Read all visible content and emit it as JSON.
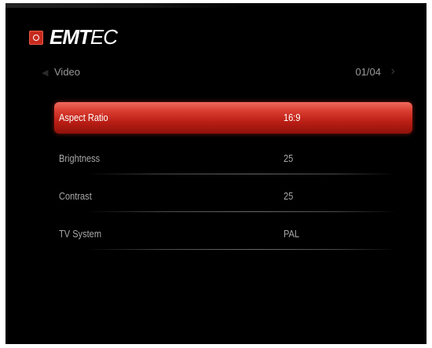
{
  "brand": {
    "logo_text_bold": "EMT",
    "logo_text_thin": "EC"
  },
  "header": {
    "section_title": "Video",
    "page_counter": "01/04"
  },
  "menu": {
    "items": [
      {
        "label": "Aspect Ratio",
        "value": "16:9",
        "selected": true
      },
      {
        "label": "Brightness",
        "value": "25",
        "selected": false
      },
      {
        "label": "Contrast",
        "value": "25",
        "selected": false
      },
      {
        "label": "TV System",
        "value": "PAL",
        "selected": false
      }
    ]
  },
  "colors": {
    "background": "#000000",
    "selection": "#c62a1e",
    "text": "#a8a8a8",
    "selected_text": "#ffffff"
  }
}
